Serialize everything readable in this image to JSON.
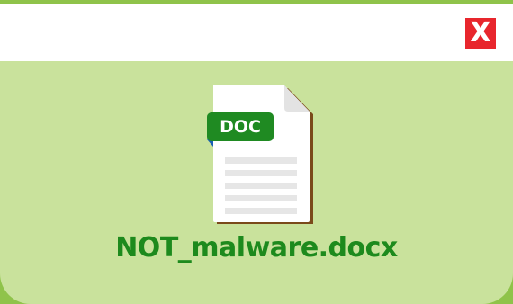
{
  "window": {
    "close_label": "X"
  },
  "file": {
    "type_badge": "DOC",
    "name": "NOT_malware.docx",
    "icon": "doc-file-icon"
  },
  "colors": {
    "background_green": "#8fc34a",
    "window_green": "#c9e29c",
    "close_red": "#e8262d",
    "text_green": "#1d8a1d",
    "badge_green": "#1f8a22"
  }
}
